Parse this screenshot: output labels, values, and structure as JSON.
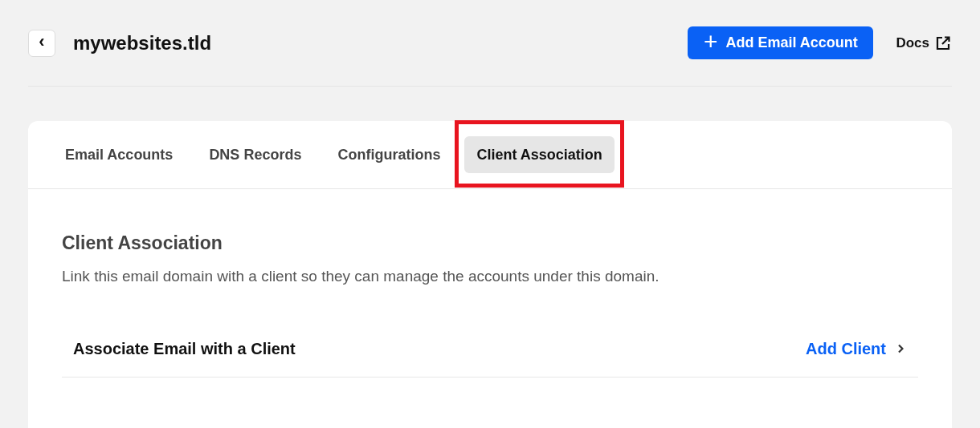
{
  "header": {
    "back_icon": "‹",
    "title": "mywebsites.tld",
    "primary_button": {
      "icon": "+",
      "label": "Add Email Account"
    },
    "docs_link": {
      "label": "Docs"
    }
  },
  "tabs": [
    {
      "label": "Email Accounts",
      "selected": false,
      "highlighted": false
    },
    {
      "label": "DNS Records",
      "selected": false,
      "highlighted": false
    },
    {
      "label": "Configurations",
      "selected": false,
      "highlighted": false
    },
    {
      "label": "Client Association",
      "selected": true,
      "highlighted": true
    }
  ],
  "section": {
    "title": "Client Association",
    "description": "Link this email domain with a client so they can manage the accounts under this domain."
  },
  "rows": [
    {
      "label": "Associate Email with a Client",
      "action": "Add Client"
    }
  ]
}
